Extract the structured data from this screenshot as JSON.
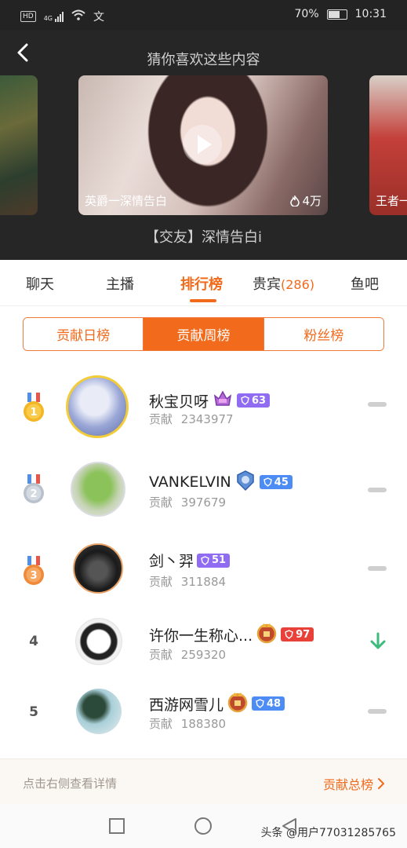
{
  "status_bar": {
    "network": "HD",
    "signal_type": "4G",
    "ime": "文",
    "battery_percent": "70%",
    "battery_level": 0.7,
    "time": "10:31"
  },
  "recommend": {
    "title": "猜你喜欢这些内容",
    "main_card": {
      "caption": "英爵一深情告白",
      "views": "4万"
    },
    "right_card": {
      "caption": "王者一"
    },
    "video_title": "【交友】深情告白i"
  },
  "tabs": [
    {
      "label": "聊天"
    },
    {
      "label": "主播"
    },
    {
      "label": "排行榜"
    },
    {
      "label": "贵宾",
      "count": "(286)"
    },
    {
      "label": "鱼吧"
    }
  ],
  "subtabs": [
    {
      "label": "贡献日榜"
    },
    {
      "label": "贡献周榜"
    },
    {
      "label": "粉丝榜"
    }
  ],
  "ranking": {
    "contrib_label": "贡献",
    "rows": [
      {
        "rank": "1",
        "name": "秋宝贝呀",
        "level": "63",
        "contribution": "2343977",
        "trend": "flat"
      },
      {
        "rank": "2",
        "name": "VANKELVIN",
        "level": "45",
        "contribution": "397679",
        "trend": "flat"
      },
      {
        "rank": "3",
        "name": "剑丶羿",
        "level": "51",
        "contribution": "311884",
        "trend": "flat"
      },
      {
        "rank": "4",
        "name": "许你一生称心...",
        "level": "97",
        "contribution": "259320",
        "trend": "down"
      },
      {
        "rank": "5",
        "name": "西游网雪儿",
        "level": "48",
        "contribution": "188380",
        "trend": "flat"
      }
    ]
  },
  "footer": {
    "hint": "点击右侧查看详情",
    "link": "贡献总榜"
  },
  "watermark": "头条 @用户77031285765",
  "colors": {
    "accent": "#f26a1b",
    "level_purple": "#8f6cf2",
    "level_blue": "#4d8cf5",
    "level_red": "#e8413a",
    "trend_down": "#3dbb7b"
  }
}
